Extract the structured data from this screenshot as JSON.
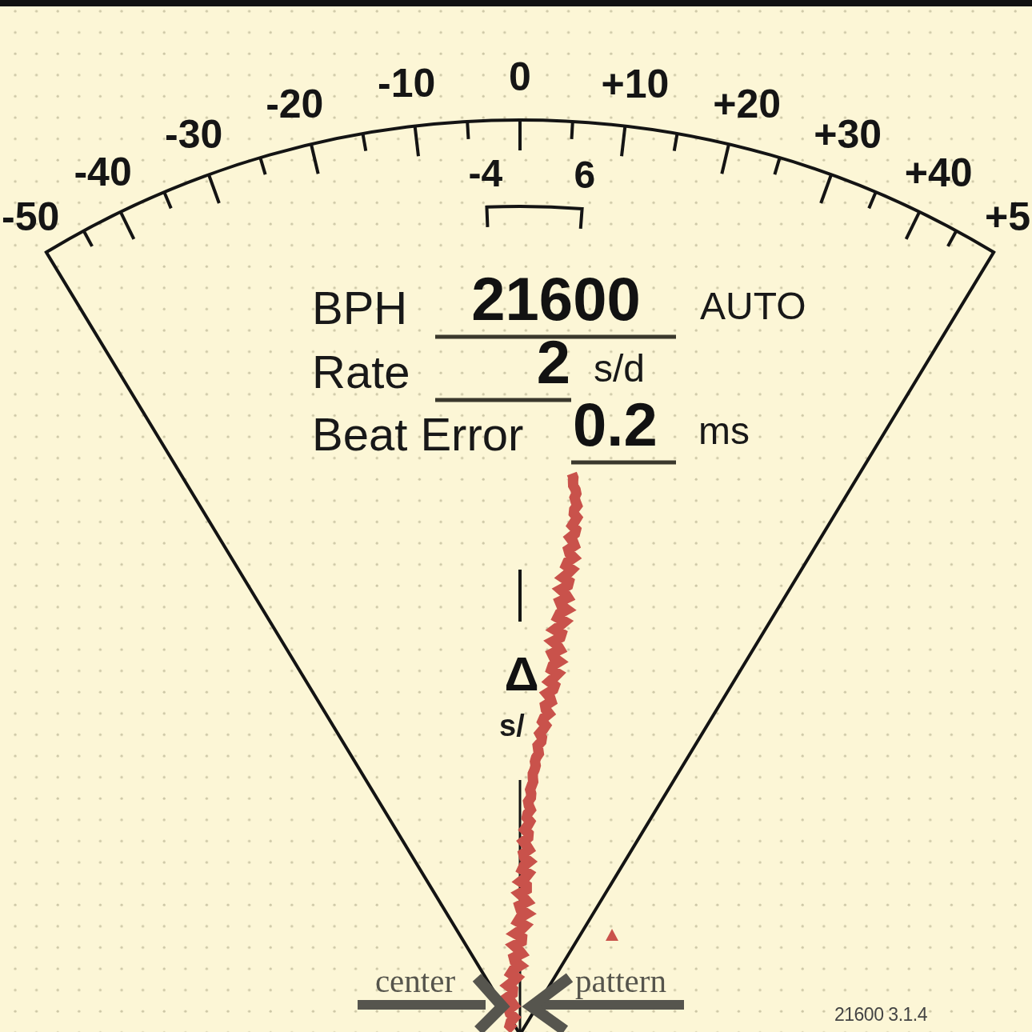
{
  "dial": {
    "scale_labels": [
      "-50",
      "-40",
      "-30",
      "-20",
      "-10",
      "0",
      "+10",
      "+20",
      "+30",
      "+40",
      "+5"
    ],
    "range_labels": [
      "-4",
      "6"
    ]
  },
  "readings": [
    {
      "label": "BPH",
      "value": "21600",
      "unit": "AUTO"
    },
    {
      "label": "Rate",
      "value": "2",
      "unit": "s/d"
    },
    {
      "label": "Beat Error",
      "value": "0.2",
      "unit": "ms"
    }
  ],
  "axis": {
    "symbol": "Δ",
    "unit": "s/"
  },
  "arrow_labels": [
    "center",
    "pattern"
  ],
  "version": "21600 3.1.4"
}
